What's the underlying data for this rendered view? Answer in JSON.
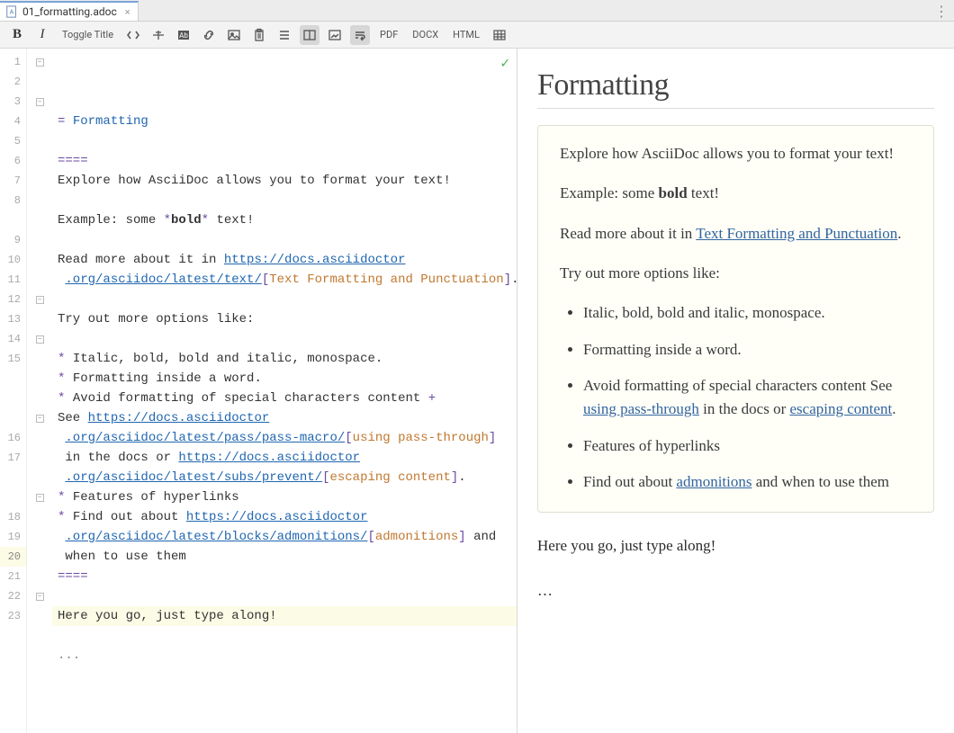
{
  "tab": {
    "filename": "01_formatting.adoc"
  },
  "toolbar": {
    "toggle_title": "Toggle Title",
    "pdf": "PDF",
    "docx": "DOCX",
    "html": "HTML"
  },
  "editor": {
    "current_line": 20,
    "lines": [
      {
        "n": 1,
        "fold": true,
        "segs": [
          {
            "t": "= ",
            "c": "k-prp"
          },
          {
            "t": "Formatting",
            "c": "k-head"
          }
        ]
      },
      {
        "n": 2,
        "segs": []
      },
      {
        "n": 3,
        "fold": true,
        "segs": [
          {
            "t": "====",
            "c": "k-prp"
          }
        ]
      },
      {
        "n": 4,
        "segs": [
          {
            "t": "Explore how AsciiDoc allows you to format your text!"
          }
        ]
      },
      {
        "n": 5,
        "segs": []
      },
      {
        "n": 6,
        "segs": [
          {
            "t": "Example: some "
          },
          {
            "t": "*",
            "c": "k-prp"
          },
          {
            "t": "bold",
            "c": "k-bold"
          },
          {
            "t": "*",
            "c": "k-prp"
          },
          {
            "t": " text!"
          }
        ]
      },
      {
        "n": 7,
        "segs": []
      },
      {
        "n": 8,
        "segs": [
          {
            "t": "Read more about it in "
          },
          {
            "t": "https://docs.asciidoctor",
            "c": "k-link"
          }
        ]
      },
      {
        "n": null,
        "segs": [
          {
            "t": " "
          },
          {
            "t": ".org/asciidoc/latest/text/",
            "c": "k-link"
          },
          {
            "t": "[",
            "c": "k-prp"
          },
          {
            "t": "Text Formatting and Punctuation",
            "c": "k-org"
          },
          {
            "t": "]",
            "c": "k-prp"
          },
          {
            "t": "."
          }
        ]
      },
      {
        "n": 9,
        "segs": []
      },
      {
        "n": 10,
        "segs": [
          {
            "t": "Try out more options like:"
          }
        ]
      },
      {
        "n": 11,
        "segs": []
      },
      {
        "n": 12,
        "fold": true,
        "segs": [
          {
            "t": "* ",
            "c": "k-prp"
          },
          {
            "t": "Italic, bold, bold and italic, monospace."
          }
        ]
      },
      {
        "n": 13,
        "segs": [
          {
            "t": "* ",
            "c": "k-prp"
          },
          {
            "t": "Formatting inside a word."
          }
        ]
      },
      {
        "n": 14,
        "fold": true,
        "segs": [
          {
            "t": "* ",
            "c": "k-prp"
          },
          {
            "t": "Avoid formatting of special characters content "
          },
          {
            "t": "+",
            "c": "k-prp"
          }
        ]
      },
      {
        "n": 15,
        "segs": [
          {
            "t": "See "
          },
          {
            "t": "https://docs.asciidoctor",
            "c": "k-link"
          }
        ]
      },
      {
        "n": null,
        "segs": [
          {
            "t": " "
          },
          {
            "t": ".org/asciidoc/latest/pass/pass-macro/",
            "c": "k-link"
          },
          {
            "t": "[",
            "c": "k-prp"
          },
          {
            "t": "using pass-through",
            "c": "k-org"
          },
          {
            "t": "]",
            "c": "k-prp"
          }
        ]
      },
      {
        "n": null,
        "segs": [
          {
            "t": " in the docs or "
          },
          {
            "t": "https://docs.asciidoctor",
            "c": "k-link"
          }
        ]
      },
      {
        "n": null,
        "fold": true,
        "segs": [
          {
            "t": " "
          },
          {
            "t": ".org/asciidoc/latest/subs/prevent/",
            "c": "k-link"
          },
          {
            "t": "[",
            "c": "k-prp"
          },
          {
            "t": "escaping content",
            "c": "k-org"
          },
          {
            "t": "]",
            "c": "k-prp"
          },
          {
            "t": "."
          }
        ]
      },
      {
        "n": 16,
        "segs": [
          {
            "t": "* ",
            "c": "k-prp"
          },
          {
            "t": "Features of hyperlinks"
          }
        ]
      },
      {
        "n": 17,
        "segs": [
          {
            "t": "* ",
            "c": "k-prp"
          },
          {
            "t": "Find out about "
          },
          {
            "t": "https://docs.asciidoctor",
            "c": "k-link"
          }
        ]
      },
      {
        "n": null,
        "segs": [
          {
            "t": " "
          },
          {
            "t": ".org/asciidoc/latest/blocks/admonitions/",
            "c": "k-link"
          },
          {
            "t": "[",
            "c": "k-prp"
          },
          {
            "t": "admonitions",
            "c": "k-org"
          },
          {
            "t": "]",
            "c": "k-prp"
          },
          {
            "t": " and"
          }
        ]
      },
      {
        "n": null,
        "fold": true,
        "segs": [
          {
            "t": " when to use them"
          }
        ]
      },
      {
        "n": 18,
        "segs": [
          {
            "t": "====",
            "c": "k-prp"
          }
        ]
      },
      {
        "n": 19,
        "segs": []
      },
      {
        "n": 20,
        "hl": true,
        "segs": [
          {
            "t": "Here you go, just type along!"
          }
        ]
      },
      {
        "n": 21,
        "segs": []
      },
      {
        "n": 22,
        "fold": true,
        "segs": [
          {
            "t": "...",
            "c": "k-gray"
          }
        ]
      },
      {
        "n": 23,
        "segs": []
      }
    ]
  },
  "preview": {
    "title": "Formatting",
    "p1": "Explore how AsciiDoc allows you to format your text!",
    "p2_pre": "Example: some ",
    "p2_bold": "bold",
    "p2_post": " text!",
    "p3_pre": "Read more about it in ",
    "p3_link": "Text Formatting and Punctuation",
    "p3_post": ".",
    "p4": "Try out more options like:",
    "li1": "Italic, bold, bold and italic, monospace.",
    "li2": "Formatting inside a word.",
    "li3_a": "Avoid formatting of special characters content See ",
    "li3_l1": "using pass-through",
    "li3_b": " in the docs or ",
    "li3_l2": "escaping content",
    "li3_c": ".",
    "li4": "Features of hyperlinks",
    "li5_a": "Find out about ",
    "li5_l": "admonitions",
    "li5_b": " and when to use them",
    "after1": "Here you go, just type along!",
    "after2": "…"
  }
}
